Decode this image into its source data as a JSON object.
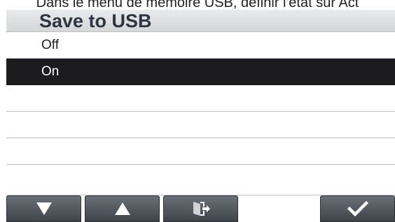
{
  "caption": {
    "text": "Dans le menu de mémoire USB, définir l'état sur Act"
  },
  "header": {
    "title": "Save to USB"
  },
  "options": [
    {
      "label": "Off",
      "selected": false
    },
    {
      "label": "On",
      "selected": true
    },
    {
      "label": "",
      "selected": false
    },
    {
      "label": "",
      "selected": false
    },
    {
      "label": "",
      "selected": false
    },
    {
      "label": "",
      "selected": false
    }
  ],
  "toolbar": {
    "buttons": [
      {
        "icon": "down-triangle-icon"
      },
      {
        "icon": "up-triangle-icon"
      },
      {
        "icon": "exit-door-icon"
      },
      {
        "icon": "checkmark-icon"
      }
    ]
  },
  "colors": {
    "selected_row": "#1c1c1e",
    "button": "#55595f",
    "title_bar": "#dfe0e3"
  }
}
